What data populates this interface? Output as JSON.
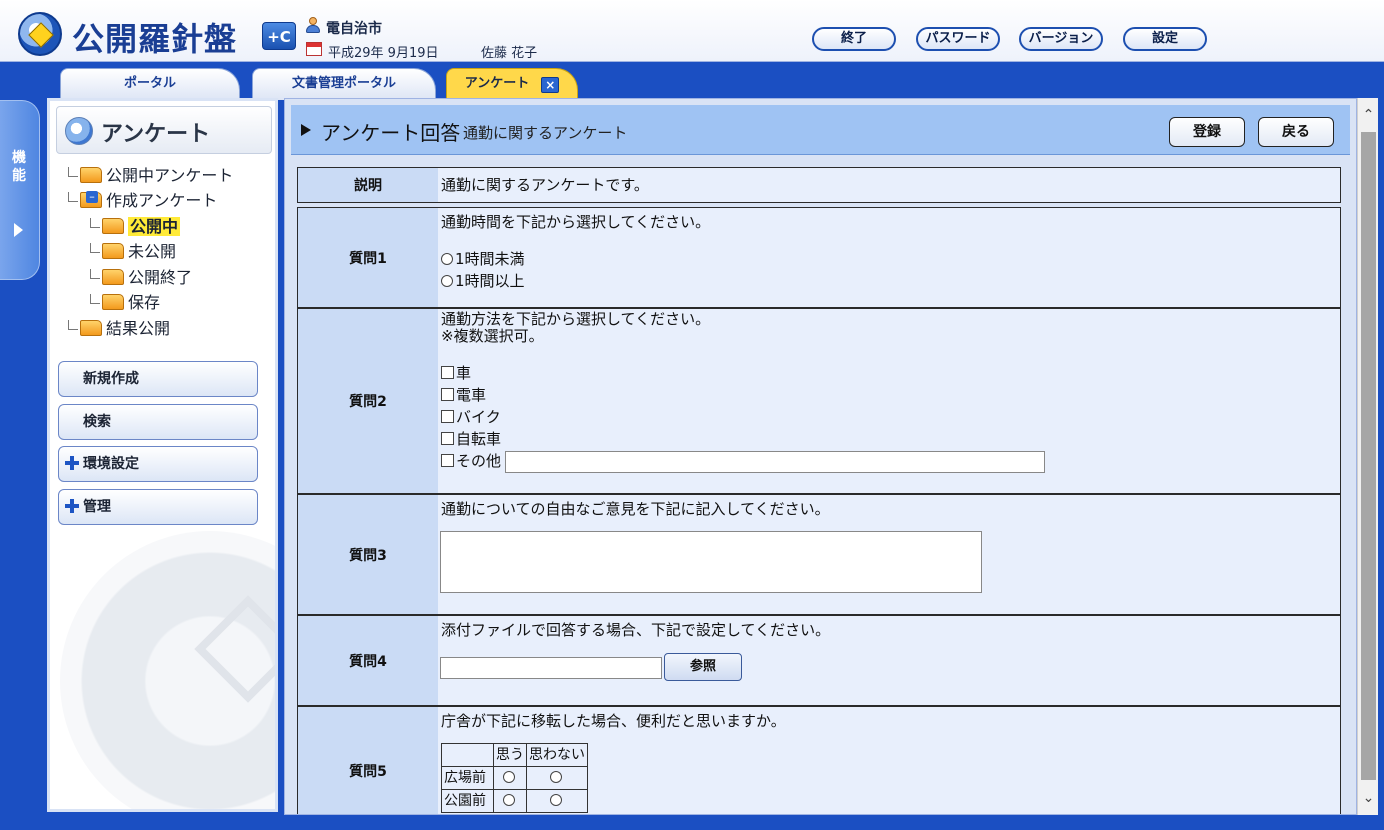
{
  "header": {
    "logo_text": "公開羅針盤",
    "logo_badge": "+C",
    "org_name": "電自治市",
    "date": "平成29年 9月19日",
    "user_name": "佐藤 花子",
    "buttons": {
      "exit": "終了",
      "password": "パスワード",
      "version": "バージョン",
      "settings": "設定"
    }
  },
  "tabs": [
    {
      "label": "ポータル"
    },
    {
      "label": "文書管理ポータル"
    },
    {
      "label": "アンケート",
      "close": "×"
    }
  ],
  "side_strip": {
    "label": "機能"
  },
  "left_panel": {
    "title": "アンケート",
    "tree": {
      "public_surveys": "公開中アンケート",
      "created_surveys": "作成アンケート",
      "created_public": "公開中",
      "created_unpublished": "未公開",
      "created_ended": "公開終了",
      "created_saved": "保存",
      "results_public": "結果公開"
    },
    "nav": {
      "new": "新規作成",
      "search": "検索",
      "env_settings": "環境設定",
      "admin": "管理"
    }
  },
  "main": {
    "title": "アンケート回答",
    "subtitle": "通勤に関するアンケート",
    "register": "登録",
    "back": "戻る",
    "description": {
      "label": "説明",
      "text": "通勤に関するアンケートです。"
    },
    "q1": {
      "label": "質問1",
      "text": "通勤時間を下記から選択してください。",
      "options": [
        "1時間未満",
        "1時間以上"
      ]
    },
    "q2": {
      "label": "質問2",
      "text": "通勤方法を下記から選択してください。",
      "note": "※複数選択可。",
      "options": [
        "車",
        "電車",
        "バイク",
        "自転車",
        "その他"
      ]
    },
    "q3": {
      "label": "質問3",
      "text": "通勤についての自由なご意見を下記に記入してください。"
    },
    "q4": {
      "label": "質問4",
      "text": "添付ファイルで回答する場合、下記で設定してください。",
      "browse": "参照"
    },
    "q5": {
      "label": "質問5",
      "text": "庁舎が下記に移転した場合、便利だと思いますか。",
      "cols": [
        "思う",
        "思わない"
      ],
      "rows": [
        "広場前",
        "公園前"
      ]
    }
  }
}
